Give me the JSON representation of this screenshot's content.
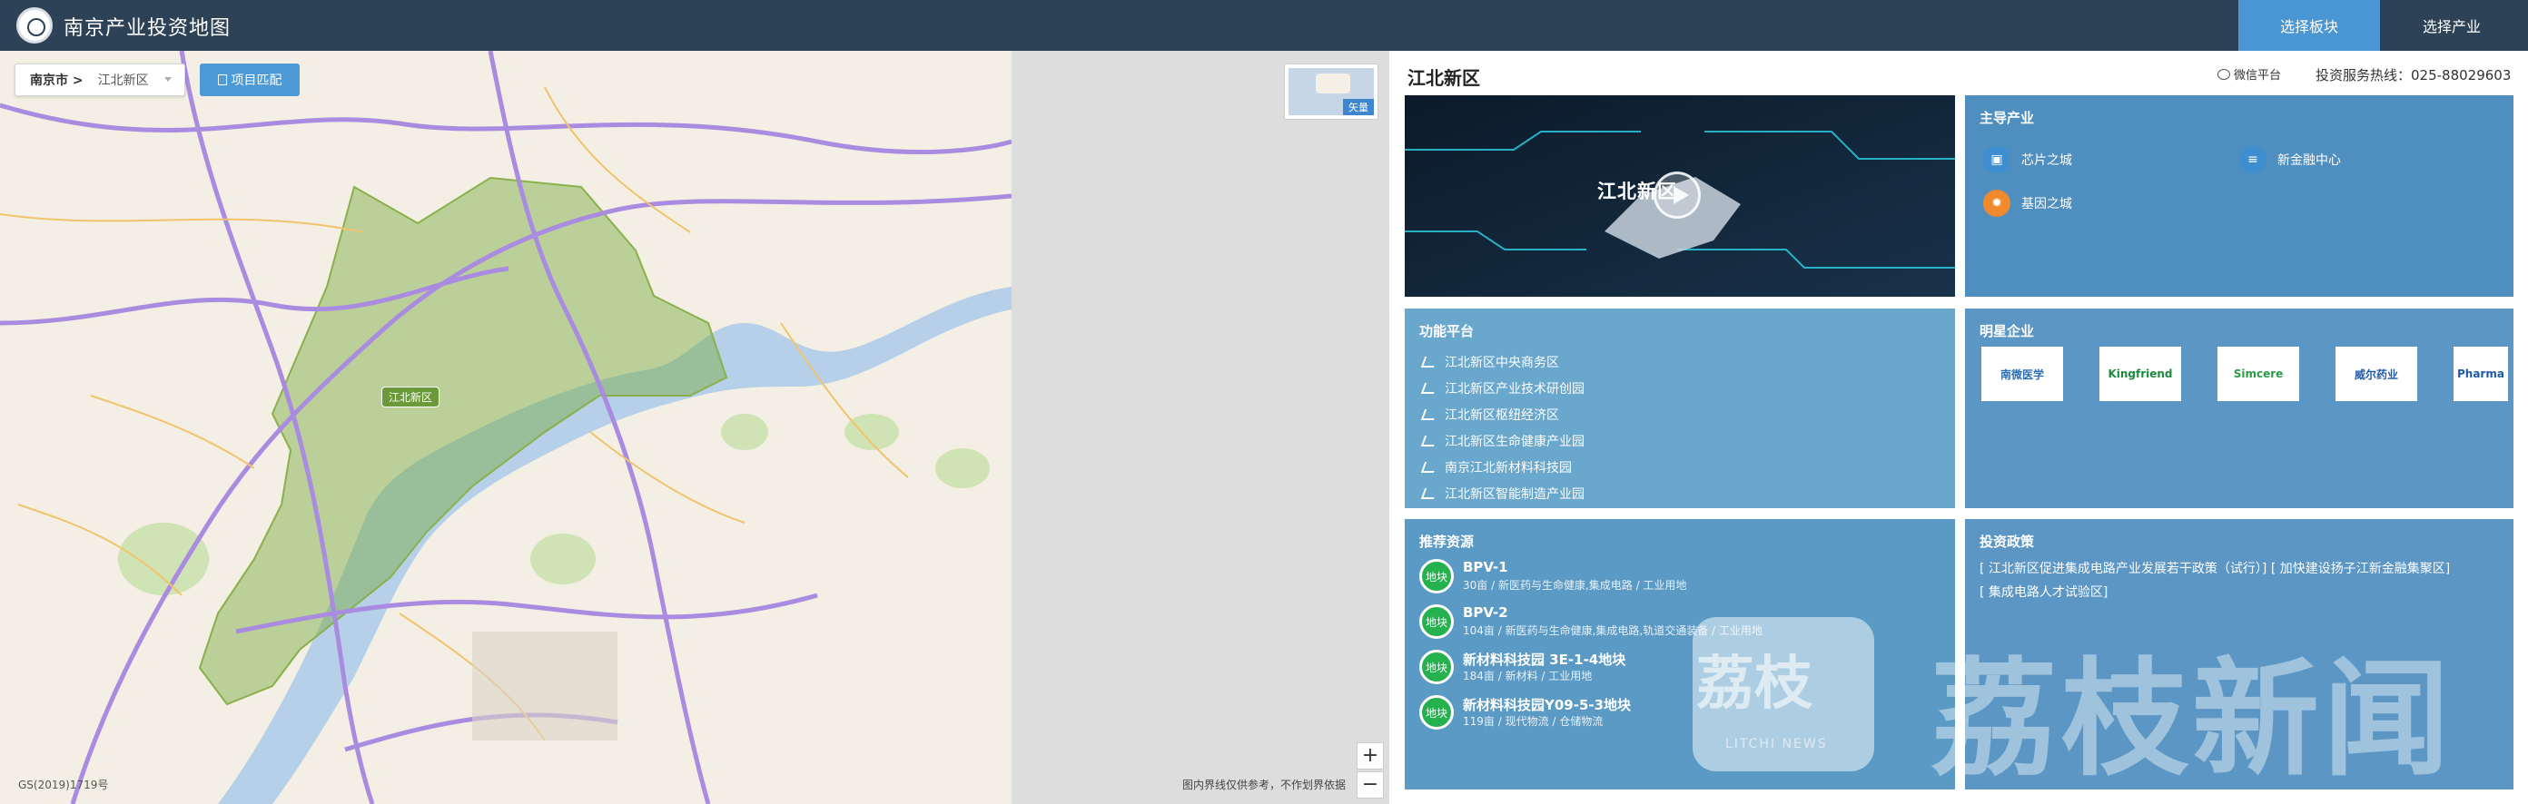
{
  "header": {
    "app_title": "南京产业投资地图",
    "nav": [
      {
        "label": "选择板块",
        "active": true
      },
      {
        "label": "选择产业",
        "active": false
      }
    ],
    "accent_color": "#4a96d3",
    "bar_color": "#2e4257"
  },
  "map": {
    "breadcrumb_city": "南京市 >",
    "breadcrumb_district": "江北新区",
    "match_button": "项目匹配",
    "district_tag": "江北新区",
    "minimap_label": "矢量",
    "zoom_in": "+",
    "zoom_out": "−",
    "gsi": "GS(2019)1719号",
    "disclaimer": "图内界线仅供参考，不作划界依据"
  },
  "panel": {
    "title": "江北新区",
    "wechat": "微信平台",
    "hotline": "投资服务热线：025-88029603",
    "video_title": "江北新区",
    "main_industry": {
      "heading": "主导产业",
      "items": [
        {
          "label": "芯片之城",
          "icon": "chip-icon",
          "color": "#3f8ed0"
        },
        {
          "label": "新金融中心",
          "icon": "coins-icon",
          "color": "#3f8ed0"
        },
        {
          "label": "基因之城",
          "icon": "gene-icon",
          "color": "#f08a2c"
        }
      ]
    },
    "platform": {
      "heading": "功能平台",
      "items": [
        "江北新区中央商务区",
        "江北新区产业技术研创园",
        "江北新区枢纽经济区",
        "江北新区生命健康产业园",
        "南京江北新材料科技园",
        "江北新区智能制造产业园"
      ]
    },
    "star_companies": {
      "heading": "明星企业",
      "items": [
        "南微医学",
        "Kingfriend",
        "Simcere",
        "威尔药业",
        "Pharma"
      ]
    },
    "resources": {
      "heading": "推荐资源",
      "badge": "地块",
      "items": [
        {
          "name": "BPV-1",
          "desc": "30亩 / 新医药与生命健康,集成电路 / 工业用地"
        },
        {
          "name": "BPV-2",
          "desc": "104亩 / 新医药与生命健康,集成电路,轨道交通装备 / 工业用地"
        },
        {
          "name": "新材料科技园 3E-1-4地块",
          "desc": "184亩 / 新材料 / 工业用地"
        },
        {
          "name": "新材料科技园Y09-5-3地块",
          "desc": "119亩 / 现代物流 / 仓储物流"
        }
      ]
    },
    "policy": {
      "heading": "投资政策",
      "lines": [
        "[ 江北新区促进集成电路产业发展若干政策（试行）]  [ 加快建设扬子江新金融集聚区]",
        "[ 集成电路人才试验区]"
      ]
    },
    "watermark": {
      "logo_text": "荔枝",
      "logo_sub": "LITCHI NEWS",
      "text": "荔枝新闻"
    }
  }
}
